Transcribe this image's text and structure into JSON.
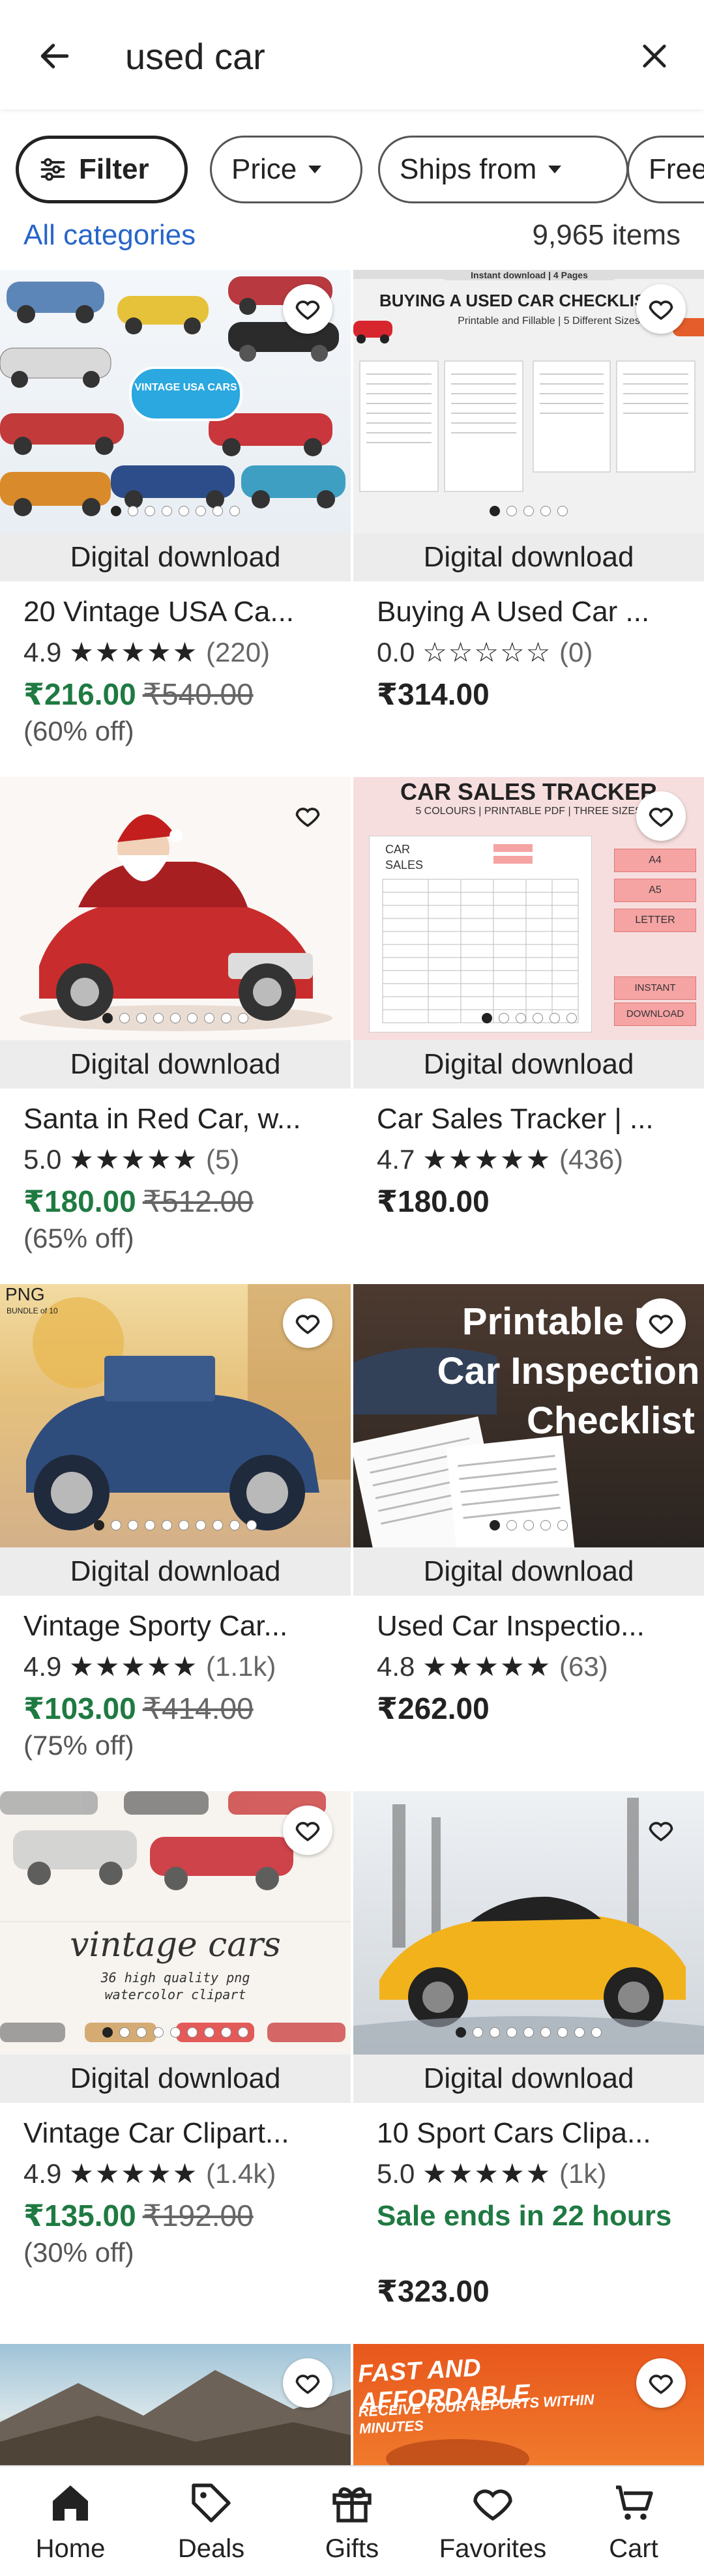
{
  "search": {
    "query": "used car"
  },
  "chips": {
    "filter": "Filter",
    "price": "Price",
    "ships_from": "Ships from",
    "free": "Free"
  },
  "results": {
    "all_categories": "All categories",
    "count": "9,965 items"
  },
  "listings": [
    {
      "badge": "Digital download",
      "title": "20 Vintage USA Ca...",
      "rating": "4.9",
      "stars": "★★★★★",
      "reviews": "(220)",
      "price": "₹216.00",
      "original_price": "₹540.00",
      "discount": "(60% off)",
      "thumb_text": "VINTAGE USA CARS"
    },
    {
      "badge": "Digital download",
      "title": "Buying A Used Car ...",
      "rating": "0.0",
      "stars": "☆☆☆☆☆",
      "reviews": "(0)",
      "price": "₹314.00",
      "thumb_top": "Instant download | 4 Pages",
      "thumb_title": "BUYING A USED CAR CHECKLIST",
      "thumb_sub": "Printable and Fillable | 5 Different Sizes"
    },
    {
      "badge": "Digital download",
      "title": "Santa in Red Car, w...",
      "rating": "5.0",
      "stars": "★★★★★",
      "reviews": "(5)",
      "price": "₹180.00",
      "original_price": "₹512.00",
      "discount": "(65% off)"
    },
    {
      "badge": "Digital download",
      "title": "Car Sales Tracker | ...",
      "rating": "4.7",
      "stars": "★★★★★",
      "reviews": "(436)",
      "price": "₹180.00",
      "thumb_title": "CAR SALES TRACKER",
      "thumb_sub": "5 COLOURS | PRINTABLE PDF | THREE SIZES",
      "thumb_sizes": [
        "A4",
        "A5",
        "LETTER"
      ],
      "thumb_tags": [
        "INSTANT",
        "DOWNLOAD"
      ],
      "thumb_form": [
        "CAR",
        "SALES"
      ]
    },
    {
      "badge": "Digital download",
      "title": "Vintage Sporty Car...",
      "rating": "4.9",
      "stars": "★★★★★",
      "reviews": "(1.1k)",
      "price": "₹103.00",
      "original_price": "₹414.00",
      "discount": "(75% off)",
      "thumb_tag": "PNG",
      "thumb_tag_sub": "BUNDLE of 10"
    },
    {
      "badge": "Digital download",
      "title": "Used Car Inspectio...",
      "rating": "4.8",
      "stars": "★★★★★",
      "reviews": "(63)",
      "price": "₹262.00",
      "thumb_lines": [
        "Printable U",
        "Car Inspection",
        "Checklist"
      ]
    },
    {
      "badge": "Digital download",
      "title": "Vintage Car Clipart...",
      "rating": "4.9",
      "stars": "★★★★★",
      "reviews": "(1.4k)",
      "price": "₹135.00",
      "original_price": "₹192.00",
      "discount": "(30% off)",
      "thumb_title": "vintage cars",
      "thumb_sub1": "36 high quality png",
      "thumb_sub2": "watercolor clipart"
    },
    {
      "badge": "Digital download",
      "title": "10 Sport Cars Clipa...",
      "rating": "5.0",
      "stars": "★★★★★",
      "reviews": "(1k)",
      "sale": "Sale ends in 22 hours",
      "price": "₹323.00"
    },
    {
      "title": ""
    },
    {
      "thumb_line1": "FAST AND AFFORDABLE",
      "thumb_line2": "RECEIVE YOUR REPORTS WITHIN MINUTES"
    }
  ],
  "bottom_nav": {
    "home": "Home",
    "deals": "Deals",
    "gifts": "Gifts",
    "favorites": "Favorites",
    "cart": "Cart"
  },
  "colors": {
    "sale_green": "#1f7a42",
    "link_blue": "#2765c9"
  }
}
